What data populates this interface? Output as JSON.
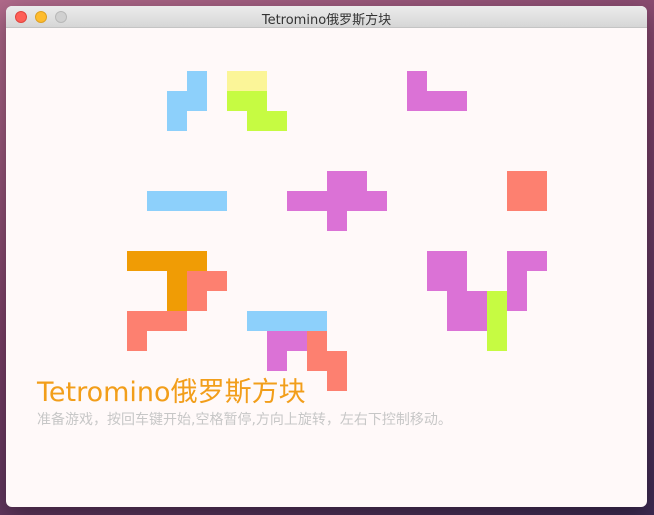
{
  "window": {
    "title": "Tetromino俄罗斯方块",
    "controls": [
      "close",
      "minimize",
      "maximize"
    ]
  },
  "game": {
    "heading": "Tetromino俄罗斯方块",
    "instructions": "准备游戏，按回车键开始,空格暂停,方向上旋转，左右下控制移动。"
  },
  "colors": {
    "sky": "#8dd0fb",
    "yellow": "#fbf598",
    "lime": "#c6fb42",
    "magenta": "#db72d6",
    "salmon": "#fd8070",
    "orange": "#f09c05"
  }
}
